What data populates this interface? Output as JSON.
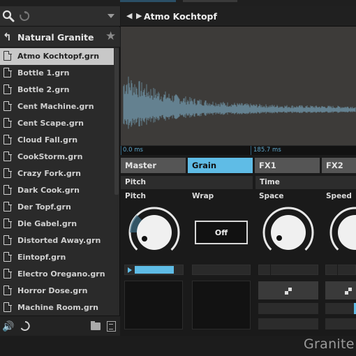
{
  "browser": {
    "folder_title": "Natural Granite",
    "files": [
      {
        "name": "Atmo Kochtopf.grn",
        "selected": true
      },
      {
        "name": "Bottle 1.grn"
      },
      {
        "name": "Bottle 2.grn"
      },
      {
        "name": "Cent Machine.grn"
      },
      {
        "name": "Cent Scape.grn"
      },
      {
        "name": "Cloud Fall.grn"
      },
      {
        "name": "CookStorm.grn"
      },
      {
        "name": "Crazy Fork.grn"
      },
      {
        "name": "Dark Cook.grn"
      },
      {
        "name": "Der Topf.grn"
      },
      {
        "name": "Die Gabel.grn"
      },
      {
        "name": "Distorted Away.grn"
      },
      {
        "name": "Eintopf.grn"
      },
      {
        "name": "Electro Oregano.grn"
      },
      {
        "name": "Horror Dose.grn"
      },
      {
        "name": "Machine Room.grn"
      }
    ]
  },
  "instrument": {
    "title": "Atmo Kochtopf",
    "nav_arrows": "◀ ▶",
    "timeline": {
      "start": "0.0 ms",
      "marker": "185.7 ms"
    },
    "tabs": [
      "Master",
      "Grain",
      "FX1",
      "FX2"
    ],
    "active_tab": "Grain",
    "sections": {
      "pitch": {
        "header": "Pitch",
        "knob_label": "Pitch",
        "wrap_label": "Wrap",
        "wrap_value": "Off"
      },
      "time": {
        "header": "Time",
        "space_label": "Space",
        "speed_label": "Speed"
      }
    }
  },
  "footer": {
    "brand": "Granite"
  },
  "colors": {
    "accent": "#5fbce6",
    "waveform": "#6b8ea0",
    "background": "#1a1a1a"
  }
}
